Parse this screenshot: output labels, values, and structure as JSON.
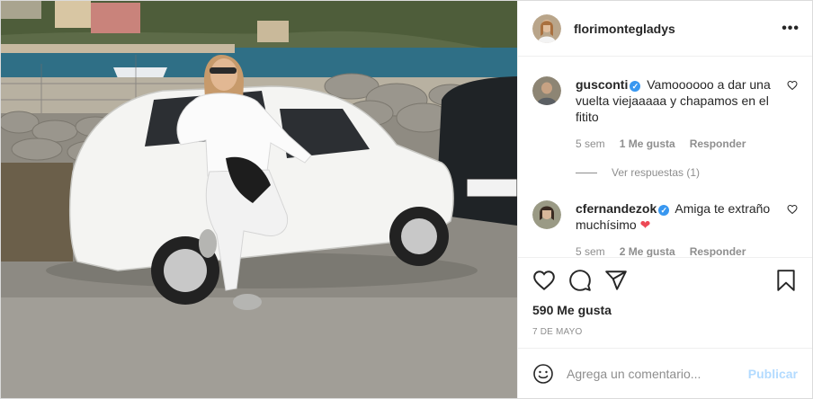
{
  "post": {
    "author": "florimontegladys"
  },
  "header": {
    "more_label": "•••"
  },
  "comments": [
    {
      "username": "gusconti",
      "text": "Vamoooooo a dar una vuelta viejaaaaa y chapamos en el fitito",
      "time": "5 sem",
      "likes": "1 Me gusta",
      "reply_label": "Responder",
      "view_replies": "Ver respuestas (1)"
    },
    {
      "username": "cfernandezok",
      "text": "Amiga te extraño muchísimo",
      "emoji": "❤",
      "time": "5 sem",
      "likes": "2 Me gusta",
      "reply_label": "Responder"
    }
  ],
  "actions": {
    "likes_count": "590 Me gusta",
    "date": "7 DE MAYO"
  },
  "add_comment": {
    "placeholder": "Agrega un comentario...",
    "publish_label": "Publicar"
  },
  "colors": {
    "verified": "#3897f0",
    "publish_disabled": "#b3dbff",
    "heart_red": "#ed4956",
    "border": "#dbdbdb"
  }
}
